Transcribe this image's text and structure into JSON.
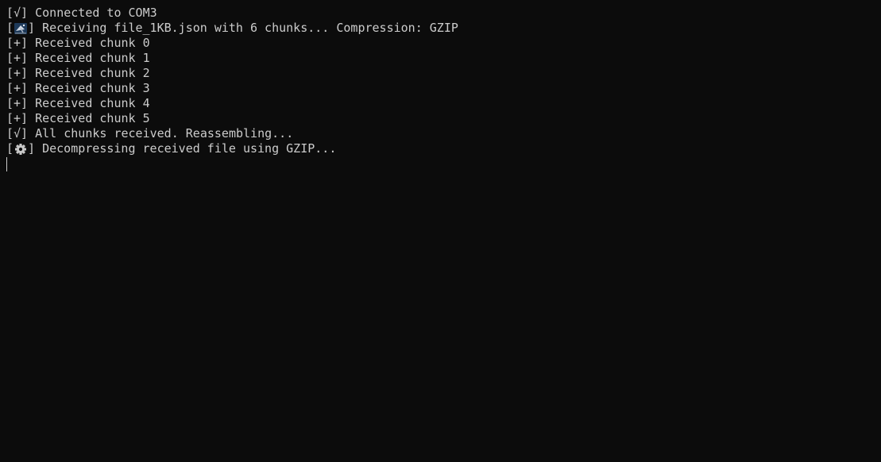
{
  "terminal": {
    "background": "#0c0c0c",
    "foreground": "#cccccc",
    "lines": [
      {
        "prefix": "[√]",
        "text": " Connected to COM3"
      },
      {
        "prefix_open": "[",
        "icon": "satellite-dish-icon",
        "prefix_close": "]",
        "text": " Receiving file_1KB.json with 6 chunks... Compression: GZIP"
      },
      {
        "prefix": "[+]",
        "text": " Received chunk 0"
      },
      {
        "prefix": "[+]",
        "text": " Received chunk 1"
      },
      {
        "prefix": "[+]",
        "text": " Received chunk 2"
      },
      {
        "prefix": "[+]",
        "text": " Received chunk 3"
      },
      {
        "prefix": "[+]",
        "text": " Received chunk 4"
      },
      {
        "prefix": "[+]",
        "text": " Received chunk 5"
      },
      {
        "prefix": "[√]",
        "text": " All chunks received. Reassembling..."
      },
      {
        "prefix_open": "[",
        "icon": "gear-icon",
        "prefix_close": "]",
        "text": " Decompressing received file using GZIP..."
      }
    ]
  }
}
